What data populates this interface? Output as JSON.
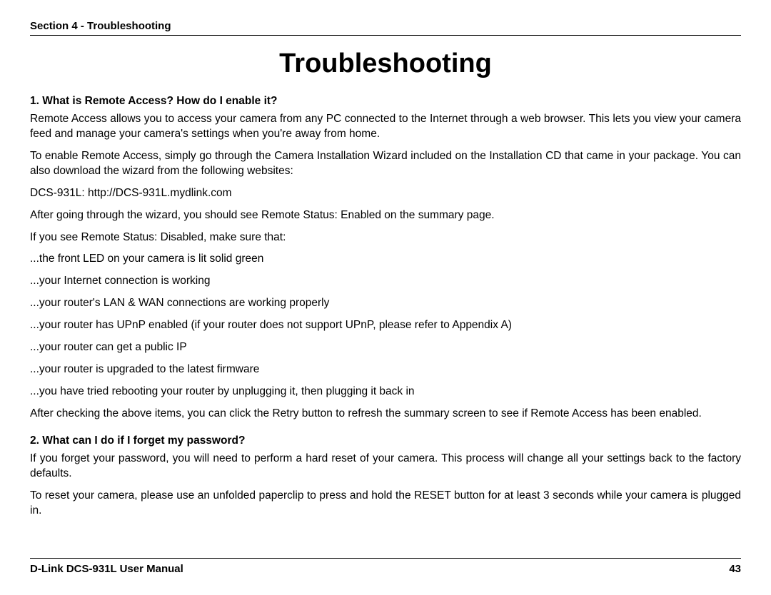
{
  "header": "Section 4 - Troubleshooting",
  "title": "Troubleshooting",
  "q1": {
    "question": "1. What is Remote Access? How do I enable it?",
    "p1": "Remote Access allows you to access your camera from any PC connected to the Internet through a web browser. This lets you view your camera feed and manage your camera's settings when you're away from home.",
    "p2": "To enable Remote Access, simply go through the Camera Installation Wizard included on the Installation CD that came in your package. You can also download the wizard from the following websites:",
    "p3": "DCS-931L: http://DCS-931L.mydlink.com",
    "p4": "After going through the wizard, you should see Remote Status: Enabled on the summary page.",
    "p5": "If you see Remote Status: Disabled, make sure that:",
    "check1": "...the front LED on your camera is lit solid green",
    "check2": "...your Internet connection is working",
    "check3": "...your router's LAN & WAN connections are working properly",
    "check4": "...your router has UPnP enabled (if your router does not support UPnP, please refer to Appendix A)",
    "check5": "...your router can get a public IP",
    "check6": "...your router is upgraded to the latest firmware",
    "check7": "...you have tried rebooting your router by unplugging it, then plugging it back in",
    "p6": "After checking the above items, you can click the Retry button to refresh the summary screen to see if Remote Access has been enabled."
  },
  "q2": {
    "question": "2. What can I do if I forget my password?",
    "p1": "If you forget your password, you will need to perform a hard reset of your camera. This process will change all your settings back to the factory defaults.",
    "p2": "To reset your camera, please use an unfolded paperclip to press and hold the RESET button for at least 3 seconds while your camera is plugged in."
  },
  "footer": {
    "left": "D-Link DCS-931L User Manual",
    "right": "43"
  }
}
